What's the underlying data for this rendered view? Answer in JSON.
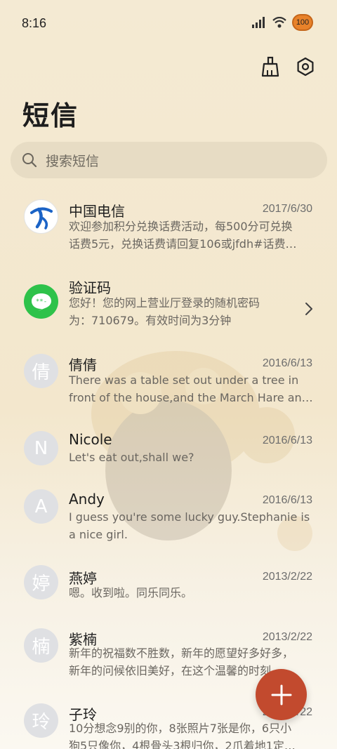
{
  "status_bar": {
    "time": "8:16",
    "battery": "100"
  },
  "header": {
    "title": "短信"
  },
  "search": {
    "placeholder": "搜索短信"
  },
  "conversations": [
    {
      "name": "中国电信",
      "date": "2017/6/30",
      "preview": [
        "欢迎参加积分兑换话费活动，每500分可兑换",
        "话费5元，兑换话费请回复106或jfdh#话费…"
      ],
      "avatar": "china-telecom-logo"
    },
    {
      "name": "验证码",
      "date": "",
      "preview": [
        "您好！您的网上营业厅登录的随机密码",
        "为：710679。有效时间为3分钟"
      ],
      "avatar": "message-bubble"
    },
    {
      "name": "倩倩",
      "date": "2016/6/13",
      "preview": [
        "There was a table set out under a tree in",
        "front of the house,and the March Hare an…"
      ],
      "avatar_letter": "倩"
    },
    {
      "name": "Nicole",
      "date": "2016/6/13",
      "preview": [
        "Let's eat out,shall we?"
      ],
      "avatar_letter": "N"
    },
    {
      "name": "Andy",
      "date": "2016/6/13",
      "preview": [
        "I guess you're some lucky guy.Stephanie is",
        "a nice girl."
      ],
      "avatar_letter": "A"
    },
    {
      "name": "燕婷",
      "date": "2013/2/22",
      "preview": [
        "嗯。收到啦。同乐同乐。"
      ],
      "avatar_letter": "婷"
    },
    {
      "name": "紫楠",
      "date": "2013/2/22",
      "preview": [
        "新年的祝福数不胜数，新年的愿望好多好多，",
        "新年的问候依旧美好，在这个温馨的时刻…"
      ],
      "avatar_letter": "楠"
    },
    {
      "name": "子玲",
      "date": "2013/2/22",
      "preview": [
        "10分想念9别的你，8张照片7张是你，6只小",
        "狗5只像你，4根骨头3根归你，2爪着地1定…"
      ],
      "avatar_letter": "玲"
    }
  ],
  "colors": {
    "accent": "#c24a2e",
    "background": "#f4ead3",
    "search_bg": "#e7dcc4"
  }
}
